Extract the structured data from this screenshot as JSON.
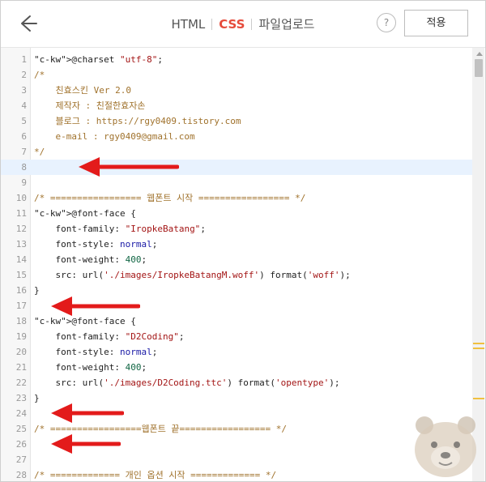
{
  "topbar": {
    "back_icon": "back-arrow-icon",
    "tabs": [
      {
        "label": "HTML",
        "active": false
      },
      {
        "label": "CSS",
        "active": true
      },
      {
        "label": "파일업로드",
        "active": false
      }
    ],
    "help_label": "?",
    "apply_label": "적용"
  },
  "editor": {
    "highlighted_line": 8,
    "lines": [
      {
        "n": "1",
        "text": "@charset \"utf-8\";"
      },
      {
        "n": "2",
        "text": "/*"
      },
      {
        "n": "3",
        "text": "    친효스킨 Ver 2.0"
      },
      {
        "n": "4",
        "text": "    제작자 : 친절한효자손"
      },
      {
        "n": "5",
        "text": "    블로그 : https://rgy0409.tistory.com"
      },
      {
        "n": "6",
        "text": "    e-mail : rgy0409@gmail.com"
      },
      {
        "n": "7",
        "text": "*/"
      },
      {
        "n": "8",
        "text": ""
      },
      {
        "n": "9",
        "text": ""
      },
      {
        "n": "10",
        "text": "/* ================= 웹폰트 시작 ================= */"
      },
      {
        "n": "11",
        "text": "@font-face {"
      },
      {
        "n": "12",
        "text": "    font-family: \"IropkeBatang\";"
      },
      {
        "n": "13",
        "text": "    font-style: normal;"
      },
      {
        "n": "14",
        "text": "    font-weight: 400;"
      },
      {
        "n": "15",
        "text": "    src: url('./images/IropkeBatangM.woff') format('woff');"
      },
      {
        "n": "16",
        "text": "}"
      },
      {
        "n": "17",
        "text": ""
      },
      {
        "n": "18",
        "text": "@font-face {"
      },
      {
        "n": "19",
        "text": "    font-family: \"D2Coding\";"
      },
      {
        "n": "20",
        "text": "    font-style: normal;"
      },
      {
        "n": "21",
        "text": "    font-weight: 400;"
      },
      {
        "n": "22",
        "text": "    src: url('./images/D2Coding.ttc') format('opentype');"
      },
      {
        "n": "23",
        "text": "}"
      },
      {
        "n": "24",
        "text": ""
      },
      {
        "n": "25",
        "text": "/* =================웹폰트 끝================= */"
      },
      {
        "n": "26",
        "text": ""
      },
      {
        "n": "27",
        "text": ""
      },
      {
        "n": "28",
        "text": "/* ============= 개인 옵션 시작 ============= */"
      }
    ]
  },
  "annotations": {
    "arrow_color": "#e31b1b",
    "arrow_count": 4
  },
  "colors": {
    "accent": "#e64b3b",
    "highlight": "#e8f2fe",
    "gutter": "#f7f7f7"
  },
  "mascot": "bear-mascot-icon"
}
